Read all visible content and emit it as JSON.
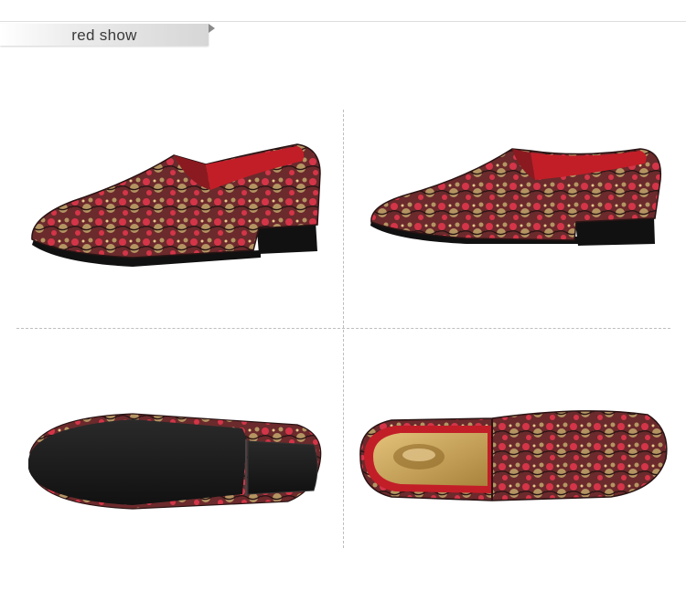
{
  "header": {
    "title": "red show"
  },
  "colors": {
    "lining_red": "#c21e28",
    "upper_base": "#7a2a2a",
    "lace_red": "#d43548",
    "lace_gold": "#b49562",
    "sole_black": "#1b1b1b",
    "insole_gold": "#c9a458"
  },
  "photos": [
    {
      "view": "side-view-left",
      "description_icon": "loafer-side-left"
    },
    {
      "view": "side-view-right",
      "description_icon": "loafer-side-right"
    },
    {
      "view": "sole-view",
      "description_icon": "loafer-sole"
    },
    {
      "view": "top-view",
      "description_icon": "loafer-top"
    }
  ]
}
